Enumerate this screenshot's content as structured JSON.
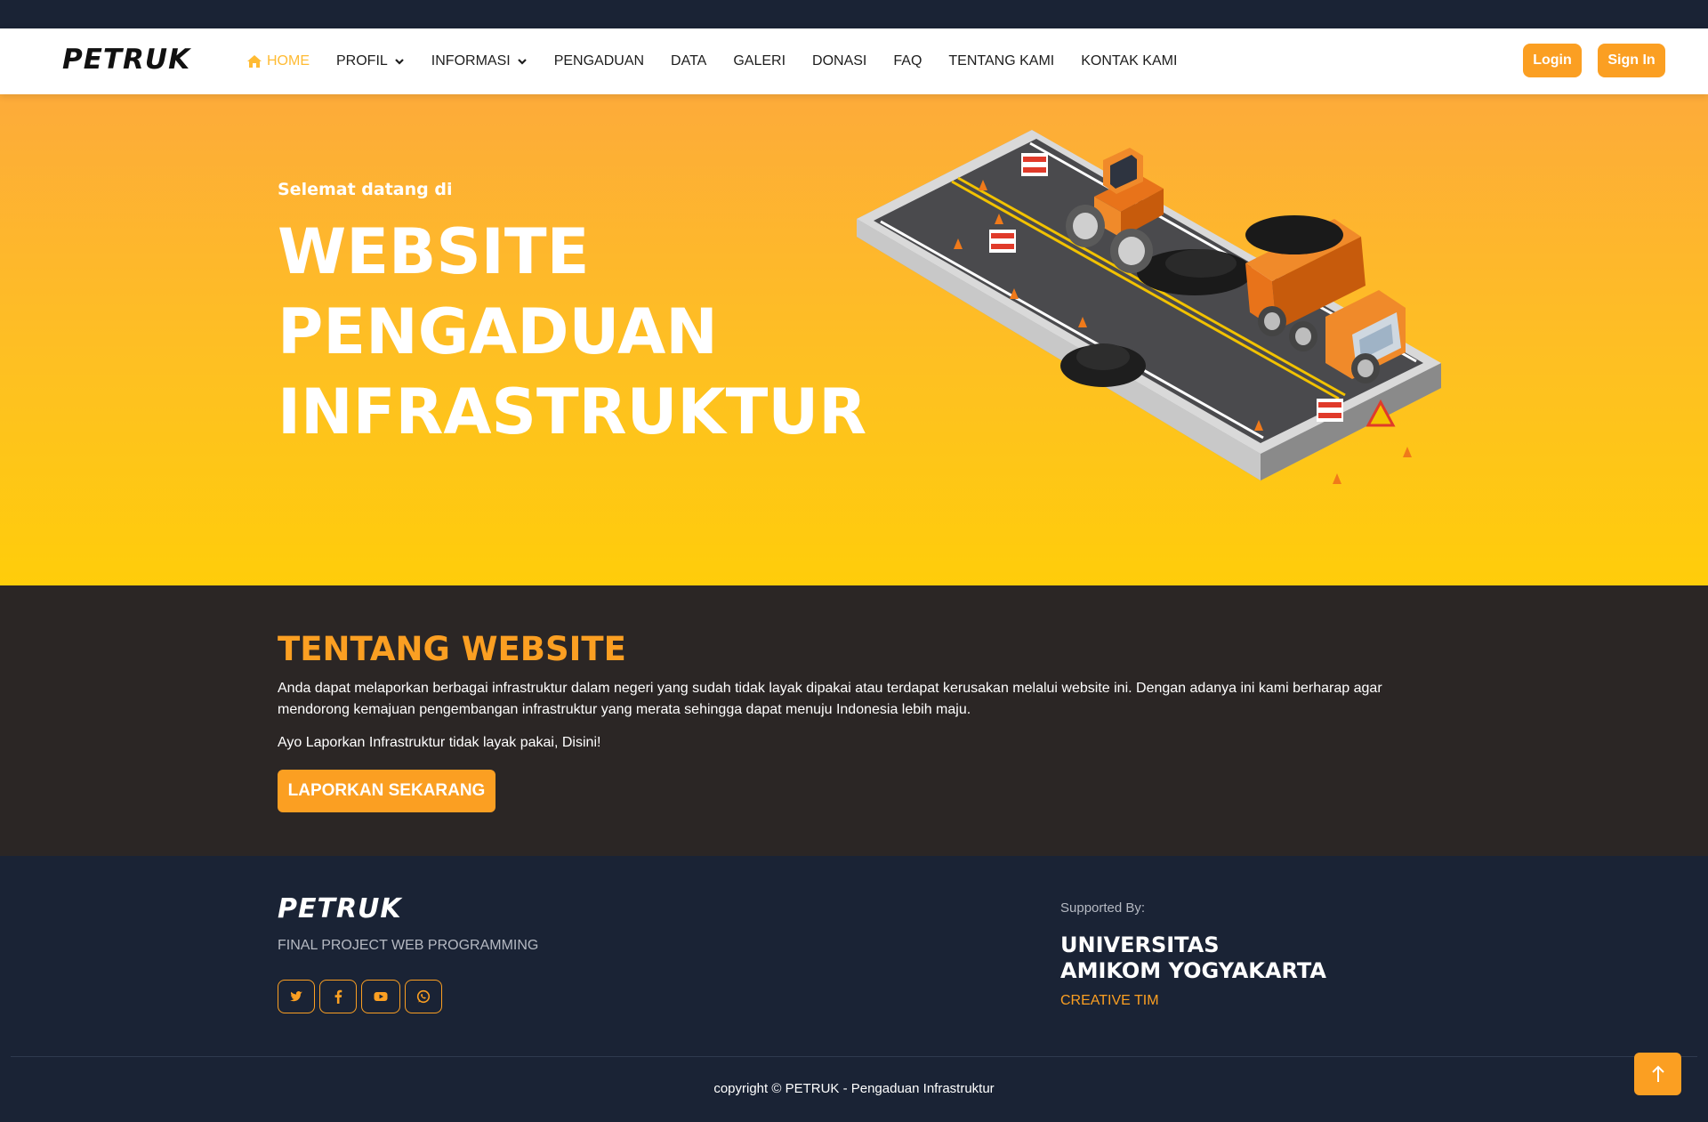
{
  "brand": "PETRUK",
  "nav": {
    "items": [
      {
        "label": "HOME",
        "icon": "home-icon",
        "active": true
      },
      {
        "label": "PROFIL",
        "dropdown": true
      },
      {
        "label": "INFORMASI",
        "dropdown": true
      },
      {
        "label": "PENGADUAN"
      },
      {
        "label": "DATA"
      },
      {
        "label": "GALERI"
      },
      {
        "label": "DONASI"
      },
      {
        "label": "FAQ"
      },
      {
        "label": "TENTANG KAMI"
      },
      {
        "label": "KONTAK KAMI"
      }
    ],
    "login_label": "Login",
    "signin_label": "Sign In"
  },
  "hero": {
    "welcome": "Selemat datang di",
    "title_lines": [
      "WEBSITE",
      "PENGADUAN",
      "INFRASTRUKTUR"
    ]
  },
  "about": {
    "title": "TENTANG WEBSITE",
    "text": "Anda dapat melaporkan berbagai infrastruktur dalam negeri yang sudah tidak layak dipakai atau terdapat kerusakan melalui website ini. Dengan adanya ini kami berharap agar mendorong kemajuan pengembangan infrastruktur yang merata sehingga dapat menuju Indonesia lebih maju.",
    "cta_text": "Ayo Laporkan Infrastruktur tidak layak pakai, Disini!",
    "button_label": "LAPORKAN SEKARANG"
  },
  "footer": {
    "brand": "PETRUK",
    "tagline": "FINAL PROJECT WEB PROGRAMMING",
    "socials": [
      "twitter-icon",
      "facebook-icon",
      "youtube-icon",
      "whatsapp-icon"
    ],
    "supported_label": "Supported By:",
    "university": "UNIVERSITAS AMIKOM YOGYAKARTA",
    "team": "CREATIVE TIM",
    "copyright": "copyright © PETRUK - Pengaduan Infrastruktur"
  },
  "colors": {
    "accent": "#fb9f22",
    "nav_active": "#ffbb33",
    "dark_navy": "#1a2335",
    "about_bg": "#2b2625"
  }
}
